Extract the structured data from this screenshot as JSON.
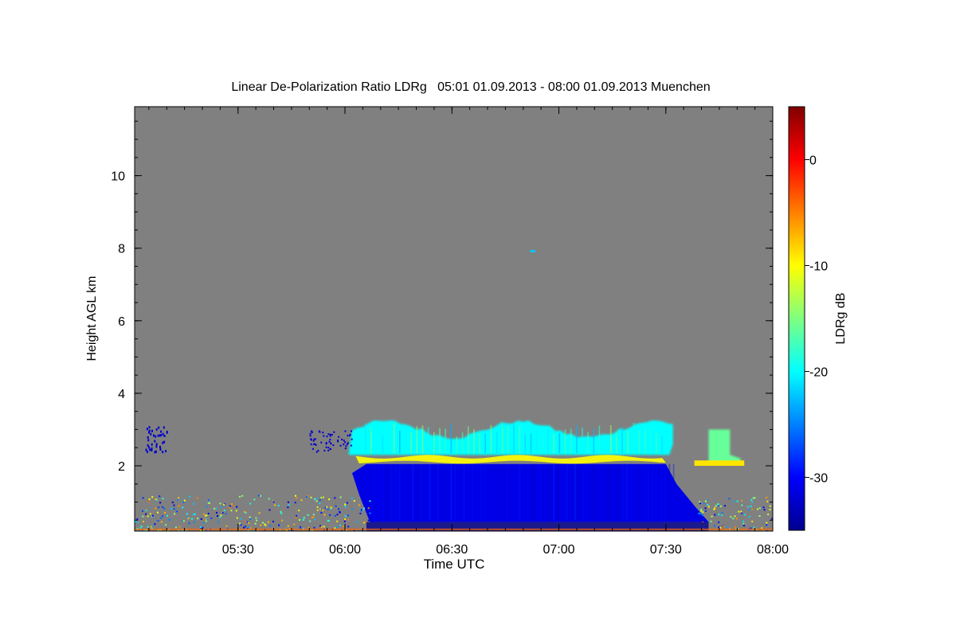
{
  "chart_data": {
    "type": "heatmap",
    "title": "Linear De-Polarization Ratio LDRg   05:01 01.09.2013 - 08:00 01.09.2013 Muenchen",
    "xlabel": "Time UTC",
    "ylabel": "Height AGL km",
    "colorbar_label": "LDRg dB",
    "x_tick_labels": [
      "05:30",
      "06:00",
      "06:30",
      "07:00",
      "07:30",
      "08:00"
    ],
    "x_tick_values": [
      330,
      360,
      390,
      420,
      450,
      480
    ],
    "xlim": [
      301,
      480
    ],
    "y_tick_labels": [
      "2",
      "4",
      "6",
      "8",
      "10"
    ],
    "y_tick_values": [
      2,
      4,
      6,
      8,
      10
    ],
    "ylim": [
      0.2,
      11.9
    ],
    "colorbar_tick_labels": [
      "0",
      "-10",
      "-20",
      "-30"
    ],
    "colorbar_tick_values": [
      0,
      -10,
      -20,
      -30
    ],
    "colorbar_range": [
      -35,
      5
    ],
    "colormap": "jet",
    "missing_color": "#808080",
    "background_value_dB": null,
    "features": [
      {
        "name": "cloud-top",
        "t": [
          361,
          451
        ],
        "h": [
          2.3,
          3.2
        ],
        "value_dB": -20
      },
      {
        "name": "cloud-base-layer",
        "t": [
          363,
          450
        ],
        "h": [
          2.1,
          2.3
        ],
        "value_dB": -10
      },
      {
        "name": "precip-column",
        "t": [
          366,
          453
        ],
        "h": [
          0.35,
          2.1
        ],
        "value_dB": -31
      },
      {
        "name": "boundary-layer-clutter",
        "t": [
          301,
          480
        ],
        "h": [
          0.2,
          1.0
        ],
        "value_dB": -18
      },
      {
        "name": "late-cloud",
        "t": [
          462,
          471
        ],
        "h": [
          2.1,
          3.0
        ],
        "value_dB": -16
      }
    ],
    "colors": {
      "missing": "#808080",
      "frame": "#000000"
    }
  }
}
